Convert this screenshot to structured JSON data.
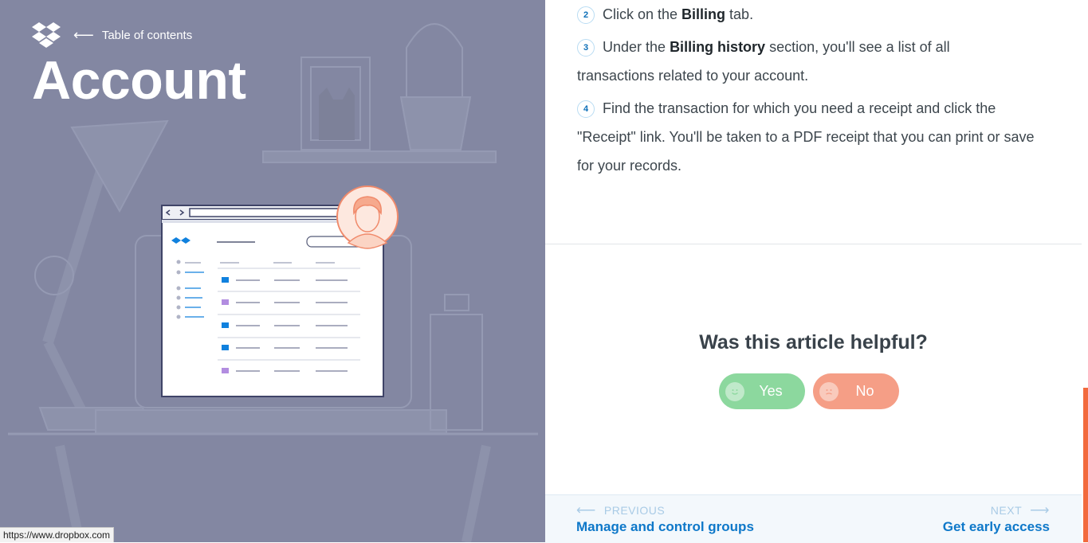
{
  "hero": {
    "toc_label": "Table of contents",
    "title": "Account",
    "icons": {
      "logo": "dropbox-logo",
      "back": "arrow-left-icon"
    },
    "background_color": "#8387a2"
  },
  "status_bar": {
    "url": "https://www.dropbox.com"
  },
  "article": {
    "steps": [
      {
        "number": "2",
        "before": "Click on the ",
        "bold": "Billing",
        "after": " tab."
      },
      {
        "number": "3",
        "before": "Under the ",
        "bold": "Billing history",
        "after": " section, you'll see a list of all transactions related to your account."
      },
      {
        "number": "4",
        "before": "Find the transaction for which you need a receipt and click the \"Receipt\" link. You'll be taken to a PDF receipt that you can print or save for your records.",
        "bold": "",
        "after": ""
      }
    ]
  },
  "feedback": {
    "title": "Was this article helpful?",
    "yes_label": "Yes",
    "no_label": "No",
    "yes_color": "#8cd89e",
    "no_color": "#f59e86"
  },
  "pager": {
    "prev_label": "PREVIOUS",
    "prev_title": "Manage and control groups",
    "next_label": "NEXT",
    "next_title": "Get early access",
    "accent_color": "#0e78c9"
  }
}
